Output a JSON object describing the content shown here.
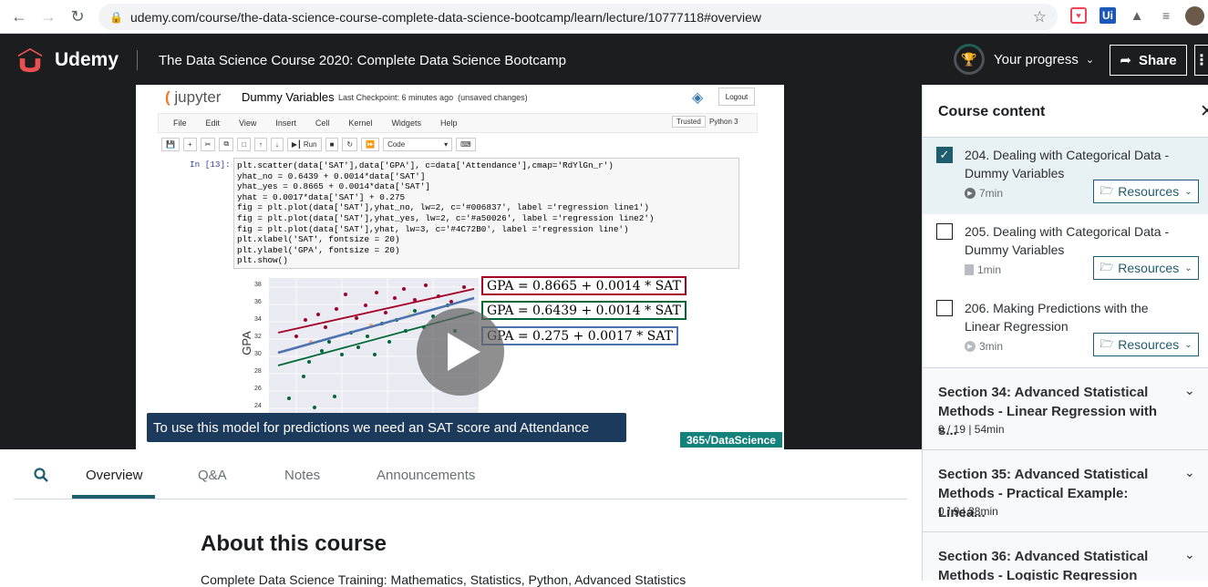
{
  "browser": {
    "url": "udemy.com/course/the-data-science-course-complete-data-science-bootcamp/learn/lecture/10777118#overview",
    "ext_ui": "Ui"
  },
  "header": {
    "brand": "Udemy",
    "course_title": "The Data Science Course 2020: Complete Data Science Bootcamp",
    "progress_label": "Your progress",
    "share_label": "Share"
  },
  "video": {
    "notebook": {
      "logo_text": "jupyter",
      "name": "Dummy Variables",
      "checkpoint": "Last Checkpoint: 6 minutes ago",
      "status": "(unsaved changes)",
      "logout": "Logout",
      "menu": [
        "File",
        "Edit",
        "View",
        "Insert",
        "Cell",
        "Kernel",
        "Widgets",
        "Help"
      ],
      "trusted": "Trusted",
      "kernel": "Python 3",
      "run_label": "Run",
      "cell_type": "Code",
      "prompt": "In [13]:",
      "code_lines": [
        "plt.scatter(data['SAT'],data['GPA'], c=data['Attendance'],cmap='RdYlGn_r')",
        "yhat_no = 0.6439 + 0.0014*data['SAT']",
        "yhat_yes = 0.8665 + 0.0014*data['SAT']",
        "yhat = 0.0017*data['SAT'] + 0.275",
        "fig = plt.plot(data['SAT'],yhat_no, lw=2, c='#006837', label ='regression line1')",
        "fig = plt.plot(data['SAT'],yhat_yes, lw=2, c='#a50026', label ='regression line2')",
        "fig = plt.plot(data['SAT'],yhat, lw=3, c='#4C72B0', label ='regression line')",
        "plt.xlabel('SAT', fontsize = 20)",
        "plt.ylabel('GPA', fontsize = 20)",
        "plt.show()"
      ],
      "plot_ylabel": "GPA",
      "plot_yticks": [
        "38",
        "36",
        "34",
        "32",
        "30",
        "28",
        "26",
        "24"
      ],
      "equations": [
        {
          "text": "GPA = 0.8665 + 0.0014 * SAT",
          "color": "#a50026"
        },
        {
          "text": "GPA = 0.6439 + 0.0014 * SAT",
          "color": "#006837"
        },
        {
          "text": "GPA = 0.275 + 0.0017 * SAT",
          "color": "#4C72B0"
        }
      ]
    },
    "caption": "To use this model for predictions we need an SAT score and Attendance",
    "watermark": "365√DataScience"
  },
  "tabs": [
    "Overview",
    "Q&A",
    "Notes",
    "Announcements"
  ],
  "about": {
    "title": "About this course",
    "subtitle": "Complete Data Science Training: Mathematics, Statistics, Python, Advanced Statistics"
  },
  "sidebar": {
    "title": "Course content",
    "lectures": [
      {
        "title": "204. Dealing with Categorical Data - Dummy Variables",
        "duration": "7min",
        "type": "video",
        "checked": true,
        "resources": "Resources"
      },
      {
        "title": "205. Dealing with Categorical Data - Dummy Variables",
        "duration": "1min",
        "type": "file",
        "checked": false,
        "resources": "Resources"
      },
      {
        "title": "206. Making Predictions with the Linear Regression",
        "duration": "3min",
        "type": "video",
        "checked": false,
        "resources": "Resources"
      }
    ],
    "sections": [
      {
        "title": "Section 34: Advanced Statistical Methods - Linear Regression with s...",
        "meta": "0 / 19 | 54min"
      },
      {
        "title": "Section 35: Advanced Statistical Methods - Practical Example: Linea...",
        "meta": "0 / 9 | 38min"
      },
      {
        "title": "Section 36: Advanced Statistical Methods - Logistic Regression",
        "meta": ""
      }
    ]
  }
}
